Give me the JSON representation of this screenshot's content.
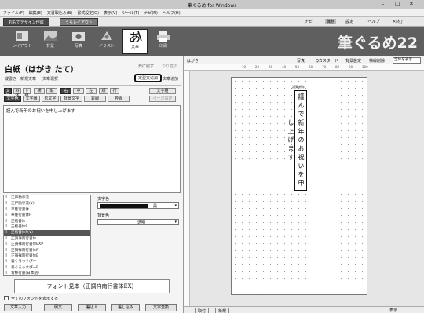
{
  "window": {
    "title": "筆ぐるめ for Windows",
    "controls": [
      "–",
      "□",
      "✕"
    ]
  },
  "menu": [
    "ファイル(F)",
    "編集(E)",
    "文書取込み(B)",
    "書式設定(O)",
    "表示(V)",
    "ツール(T)",
    "ナビ(N)",
    "ヘルプ(H)"
  ],
  "tabs": [
    {
      "label": "おもてデザイン作成"
    },
    {
      "label": "うらレイアウト"
    }
  ],
  "top_right": {
    "navi": "ナビ",
    "mode": "職務",
    "settings": "設定",
    "help": "?ヘルプ",
    "exit": "✕終了"
  },
  "ribbon": {
    "buttons": [
      {
        "label": "レイアウト"
      },
      {
        "label": "背景"
      },
      {
        "label": "写真"
      },
      {
        "label": "イラスト"
      },
      {
        "label": "文章"
      },
      {
        "label": "印刷"
      }
    ],
    "logo": "筆ぐるめ22"
  },
  "panel": {
    "title": "白紙（はがき たて）",
    "undo": "元に戻す",
    "redo": "やり直す",
    "links": [
      "縦書き",
      "新規文章",
      "文章選択"
    ],
    "highlight_link": "定型文追加",
    "add_link": "文章追加",
    "toolbar1": [
      "文字",
      "斜体",
      "下線",
      "横",
      "縦",
      "右",
      "中",
      "左",
      "順",
      "行",
      "文字組"
    ],
    "toolbar2": [
      "文字色",
      "文字縁",
      "影文字",
      "背景文字",
      "罫線",
      "枠線",
      "文字配置"
    ],
    "disabled_btn": "ページ設定",
    "text_content": "謹んで新年のお祝いを申し上げます",
    "font_label": "文字色",
    "font_color": "黒",
    "bg_label": "背景色",
    "bg_color": "透明",
    "fonts": [
      "江戸勘亭流",
      "江戸勘亭流(V)",
      "華隆行書体",
      "華隆行書体P",
      "正楷書体",
      "正楷書体P",
      "正楷書体P(V)",
      "正調祥南行書体",
      "正調祥南行書体EXP",
      "正調祥南行書体P",
      "正調祥南行書体E",
      "翁ぐろっすぴー",
      "翁ぐろっすぴーP",
      "青柳行書(日本語)",
      "青柳草書",
      "青柳隷書Std",
      "青柳隷書(V)"
    ],
    "selected_font_index": 6,
    "preview_text": "フォント見本（正調祥南行書体EX）",
    "show_all_fonts": "全てのフォントを表示する",
    "bottom_buttons": [
      "文章入力",
      "例文",
      "差込人",
      "差し込み",
      "文字変換"
    ]
  },
  "workspace": {
    "label": "はがき",
    "toolbar": [
      "写真",
      "Qカスタード",
      "背景設定",
      "横線削除"
    ],
    "zoom_select": "全体を表示",
    "ruler_marks": [
      "10",
      "20",
      "30",
      "40",
      "50",
      "60",
      "70",
      "80",
      "90",
      "100"
    ],
    "selected_label": "謹賀新年",
    "vertical_text": "謹んで新年のお祝いを申し上げます",
    "status": [
      "取付",
      "新規",
      "表示"
    ]
  }
}
